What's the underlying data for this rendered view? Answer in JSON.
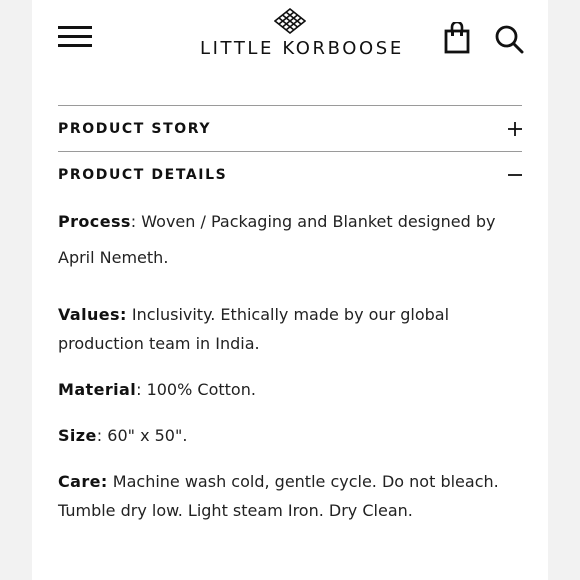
{
  "header": {
    "menu_icon": "hamburger-menu-icon",
    "logo_mark": "diamond-grid-logo-icon",
    "brand": "LITTLE KORBOOSE",
    "cart_icon": "shopping-bag-icon",
    "search_icon": "search-icon"
  },
  "accordion": [
    {
      "title": "PRODUCT STORY",
      "state": "collapsed",
      "icon": "plus-icon"
    },
    {
      "title": "PRODUCT DETAILS",
      "state": "expanded",
      "icon": "minus-icon"
    }
  ],
  "details": {
    "process": {
      "label": "Process",
      "sep": ": ",
      "text": "Woven / Packaging and Blanket designed by April Nemeth."
    },
    "values": {
      "label": "Values:",
      "sep": " ",
      "text": "Inclusivity. Ethically made by our global production team in India."
    },
    "material": {
      "label": "Material",
      "sep": ": ",
      "text": "100% Cotton."
    },
    "size": {
      "label": "Size",
      "sep": ": ",
      "text": "60\" x 50\"."
    },
    "care": {
      "label": "Care:",
      "sep": " ",
      "text": "Machine wash cold, gentle cycle. Do not bleach. Tumble dry low. Light steam Iron. Dry Clean."
    }
  },
  "colors": {
    "background": "#ffffff",
    "outer": "#f2f2f2",
    "text": "#111111",
    "divider": "#9a9a9a"
  }
}
